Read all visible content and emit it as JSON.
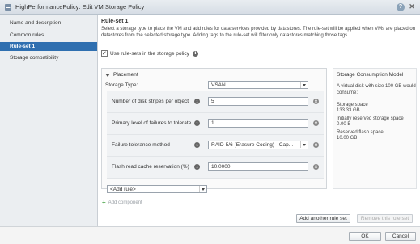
{
  "window": {
    "title": "HighPerformancePolicy: Edit VM Storage Policy",
    "help_label": "?",
    "close_label": "✕"
  },
  "sidebar": {
    "items": [
      {
        "label": "Name and description"
      },
      {
        "label": "Common rules"
      },
      {
        "label": "Rule-set 1"
      },
      {
        "label": "Storage compatibility"
      }
    ]
  },
  "main": {
    "title": "Rule-set 1",
    "description": "Select a storage type to place the VM and add rules for data services provided by datastores. The rule-set will be applied when VMs are placed on datastores from the selected storage type. Adding tags to the rule-set will filter only datastores matching those tags.",
    "use_rulesets_label": "Use rule-sets in the storage policy",
    "use_rulesets_checked": true
  },
  "placement": {
    "header": "Placement",
    "storage_type_label": "Storage Type:",
    "storage_type_value": "VSAN",
    "rules": [
      {
        "label": "Number of disk stripes per object",
        "value": "5"
      },
      {
        "label": "Primary level of failures to tolerate",
        "value": "1"
      },
      {
        "label": "Failure tolerance method",
        "value": "RAID-5/6 (Erasure Coding) - Cap..."
      },
      {
        "label": "Flash read cache reservation (%)",
        "value": "10.0000"
      }
    ],
    "add_rule_label": "<Add rule>",
    "add_component_label": "Add component"
  },
  "consumption": {
    "title": "Storage Consumption Model",
    "intro": "A virtual disk with size 100 GB would consume:",
    "storage_space_label": "Storage space",
    "storage_space_value": "133.33 GB",
    "initially_reserved_label": "Initially reserved storage space",
    "initially_reserved_value": "0.00 B",
    "reserved_flash_label": "Reserved flash space",
    "reserved_flash_value": "10.00 GB"
  },
  "actions": {
    "add_ruleset": "Add another rule set",
    "remove_ruleset": "Remove this rule set",
    "ok": "OK",
    "cancel": "Cancel"
  },
  "colors": {
    "accent": "#2f6fb0",
    "titlebar": "#dfe4ea"
  }
}
